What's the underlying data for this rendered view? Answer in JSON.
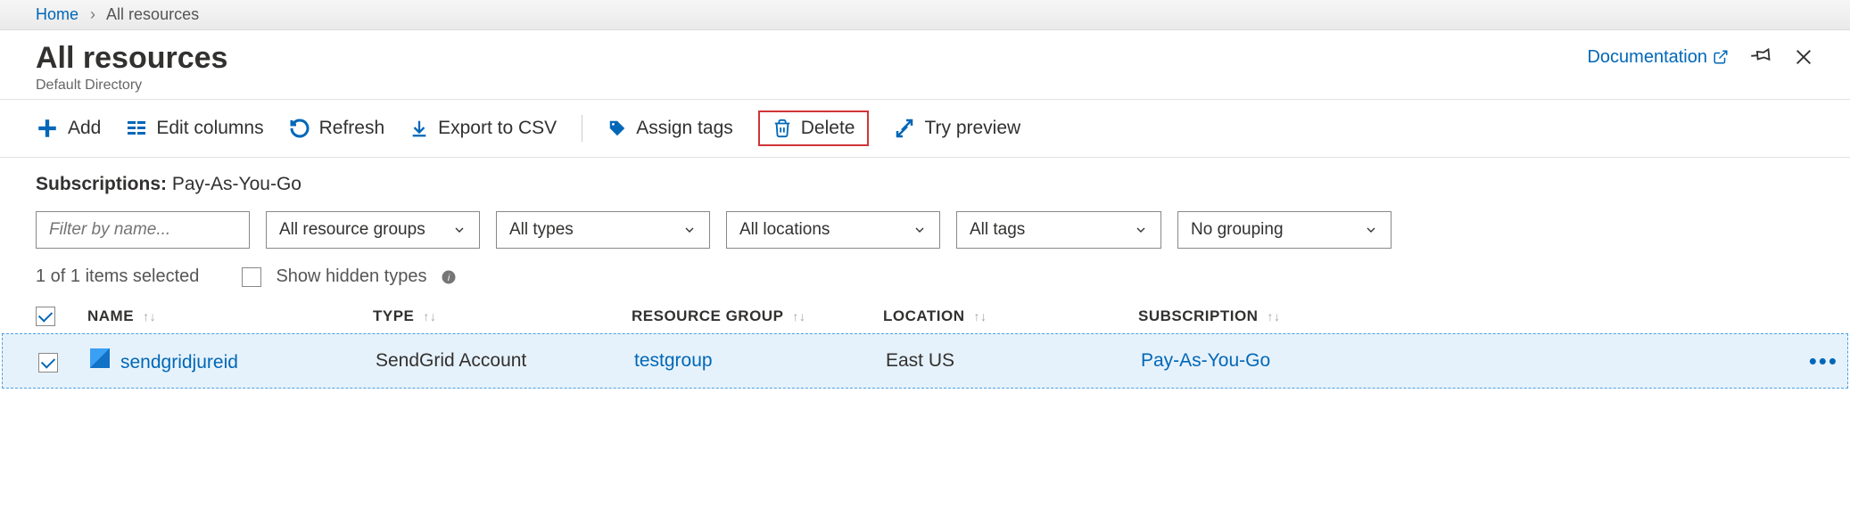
{
  "breadcrumb": {
    "home": "Home",
    "current": "All resources"
  },
  "header": {
    "title": "All resources",
    "subtitle": "Default Directory",
    "documentation": "Documentation"
  },
  "toolbar": {
    "add": "Add",
    "edit_columns": "Edit columns",
    "refresh": "Refresh",
    "export_csv": "Export to CSV",
    "assign_tags": "Assign tags",
    "delete": "Delete",
    "try_preview": "Try preview"
  },
  "filters": {
    "subs_label": "Subscriptions:",
    "subs_value": "Pay-As-You-Go",
    "filter_placeholder": "Filter by name...",
    "resource_groups": "All resource groups",
    "types": "All types",
    "locations": "All locations",
    "tags": "All tags",
    "grouping": "No grouping"
  },
  "status": {
    "selected": "1 of 1 items selected",
    "show_hidden": "Show hidden types"
  },
  "columns": {
    "name": "NAME",
    "type": "TYPE",
    "resource_group": "RESOURCE GROUP",
    "location": "LOCATION",
    "subscription": "SUBSCRIPTION"
  },
  "rows": [
    {
      "name": "sendgridjureid",
      "type": "SendGrid Account",
      "resource_group": "testgroup",
      "location": "East US",
      "subscription": "Pay-As-You-Go"
    }
  ]
}
